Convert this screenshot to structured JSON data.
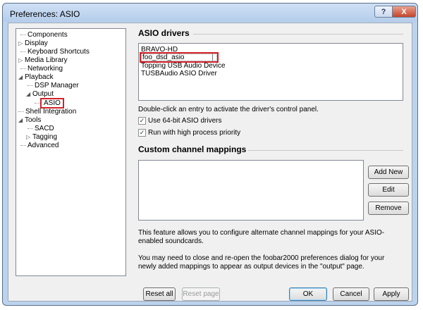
{
  "window": {
    "title": "Preferences: ASIO",
    "help_label": "?",
    "close_label": "X"
  },
  "tree": {
    "items": [
      {
        "label": "Components",
        "glyph": ""
      },
      {
        "label": "Display",
        "glyph": "▷"
      },
      {
        "label": "Keyboard Shortcuts",
        "glyph": ""
      },
      {
        "label": "Media Library",
        "glyph": "▷"
      },
      {
        "label": "Networking",
        "glyph": ""
      },
      {
        "label": "Playback",
        "glyph": "◢"
      },
      {
        "label": "DSP Manager",
        "glyph": ""
      },
      {
        "label": "Output",
        "glyph": "◢"
      },
      {
        "label": "ASIO",
        "glyph": ""
      },
      {
        "label": "Shell Integration",
        "glyph": ""
      },
      {
        "label": "Tools",
        "glyph": "◢"
      },
      {
        "label": "SACD",
        "glyph": ""
      },
      {
        "label": "Tagging",
        "glyph": "▷"
      },
      {
        "label": "Advanced",
        "glyph": ""
      }
    ]
  },
  "asio_drivers": {
    "title": "ASIO drivers",
    "drivers": [
      "BRAVO-HD",
      "foo_dsd_asio",
      "Topping USB Audio Device",
      "TUSBAudio ASIO Driver"
    ],
    "selected": "foo_dsd_asio",
    "hint": "Double-click an entry to activate the driver's control panel.",
    "use_64bit_label": "Use 64-bit ASIO drivers",
    "use_64bit_checked": true,
    "high_priority_label": "Run with high process priority",
    "high_priority_checked": true
  },
  "mappings": {
    "title": "Custom channel mappings",
    "add_label": "Add New",
    "edit_label": "Edit",
    "remove_label": "Remove",
    "info1": "This feature allows you to configure alternate channel mappings for your ASIO-enabled soundcards.",
    "info2": "You may need to close and re-open the foobar2000 preferences dialog for your newly added mappings to appear as output devices in the \"output\" page."
  },
  "footer": {
    "reset_all": "Reset all",
    "reset_page": "Reset page",
    "ok": "OK",
    "cancel": "Cancel",
    "apply": "Apply"
  }
}
